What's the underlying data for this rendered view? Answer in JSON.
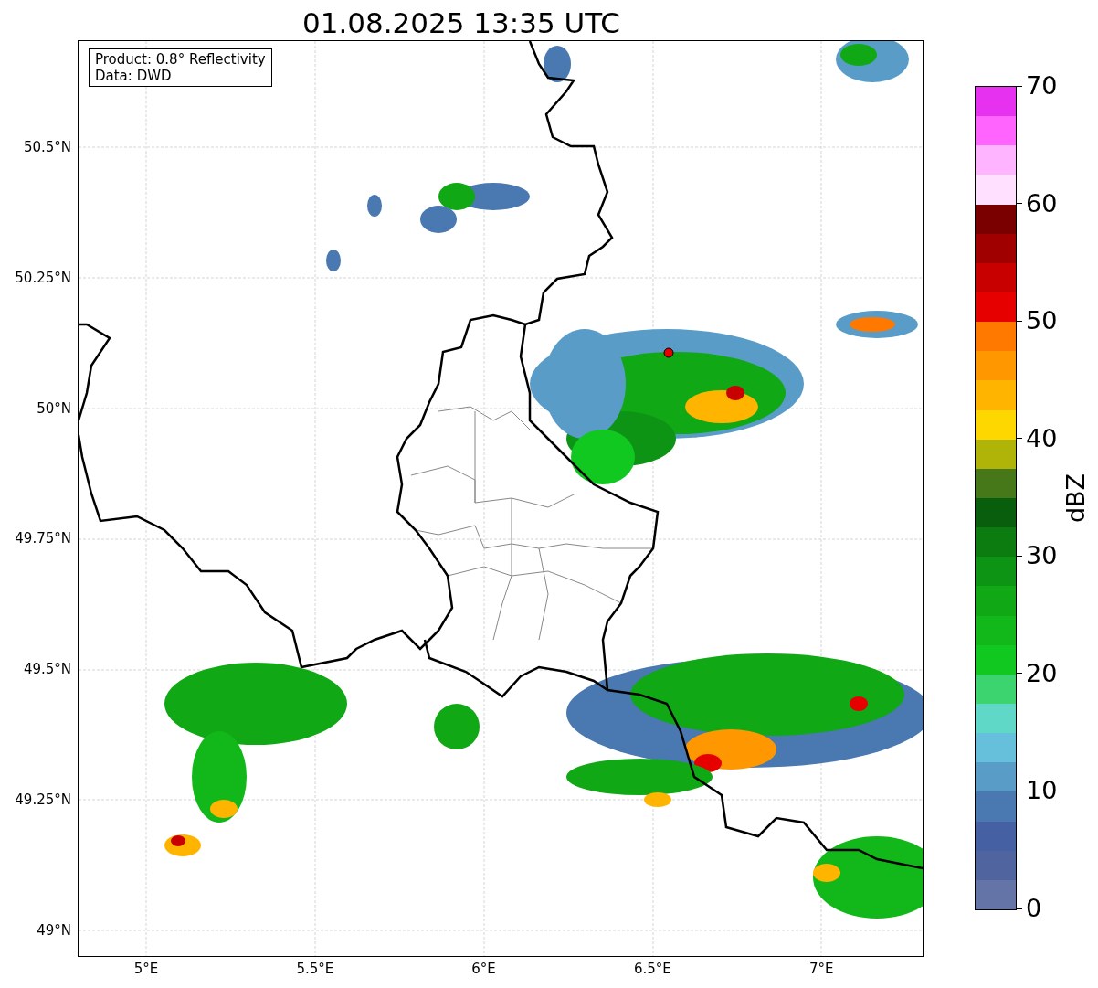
{
  "title": "01.08.2025 13:35 UTC",
  "info_box": [
    "Product: 0.8° Reflectivity",
    "Data: DWD"
  ],
  "map": {
    "y_labels": [
      "50.5°N",
      "50.25°N",
      "50°N",
      "49.75°N",
      "49.5°N",
      "49.25°N",
      "49°N"
    ],
    "x_labels": [
      "5°E",
      "5.5°E",
      "6°E",
      "6.5°E",
      "7°E"
    ]
  },
  "colorbar": {
    "label": "dBZ",
    "ticks": [
      "70",
      "60",
      "50",
      "40",
      "30",
      "20",
      "10",
      "0"
    ],
    "segments": [
      {
        "color": "#e632f0"
      },
      {
        "color": "#ff64ff"
      },
      {
        "color": "#ffb4ff"
      },
      {
        "color": "#ffe0ff"
      },
      {
        "color": "#7a0000"
      },
      {
        "color": "#a00000"
      },
      {
        "color": "#c80000"
      },
      {
        "color": "#e60000"
      },
      {
        "color": "#ff7800"
      },
      {
        "color": "#ff9800"
      },
      {
        "color": "#ffb400"
      },
      {
        "color": "#ffd700"
      },
      {
        "color": "#b0b408"
      },
      {
        "color": "#46781a"
      },
      {
        "color": "#085e0c"
      },
      {
        "color": "#0c7c10"
      },
      {
        "color": "#0e9414"
      },
      {
        "color": "#10a814"
      },
      {
        "color": "#12b81a"
      },
      {
        "color": "#10c820"
      },
      {
        "color": "#3cd46e"
      },
      {
        "color": "#60d8c8"
      },
      {
        "color": "#66c0dc"
      },
      {
        "color": "#5a9cc8"
      },
      {
        "color": "#4a78b0"
      },
      {
        "color": "#4560a3"
      },
      {
        "color": "#5064a0"
      },
      {
        "color": "#6474a6"
      }
    ]
  }
}
